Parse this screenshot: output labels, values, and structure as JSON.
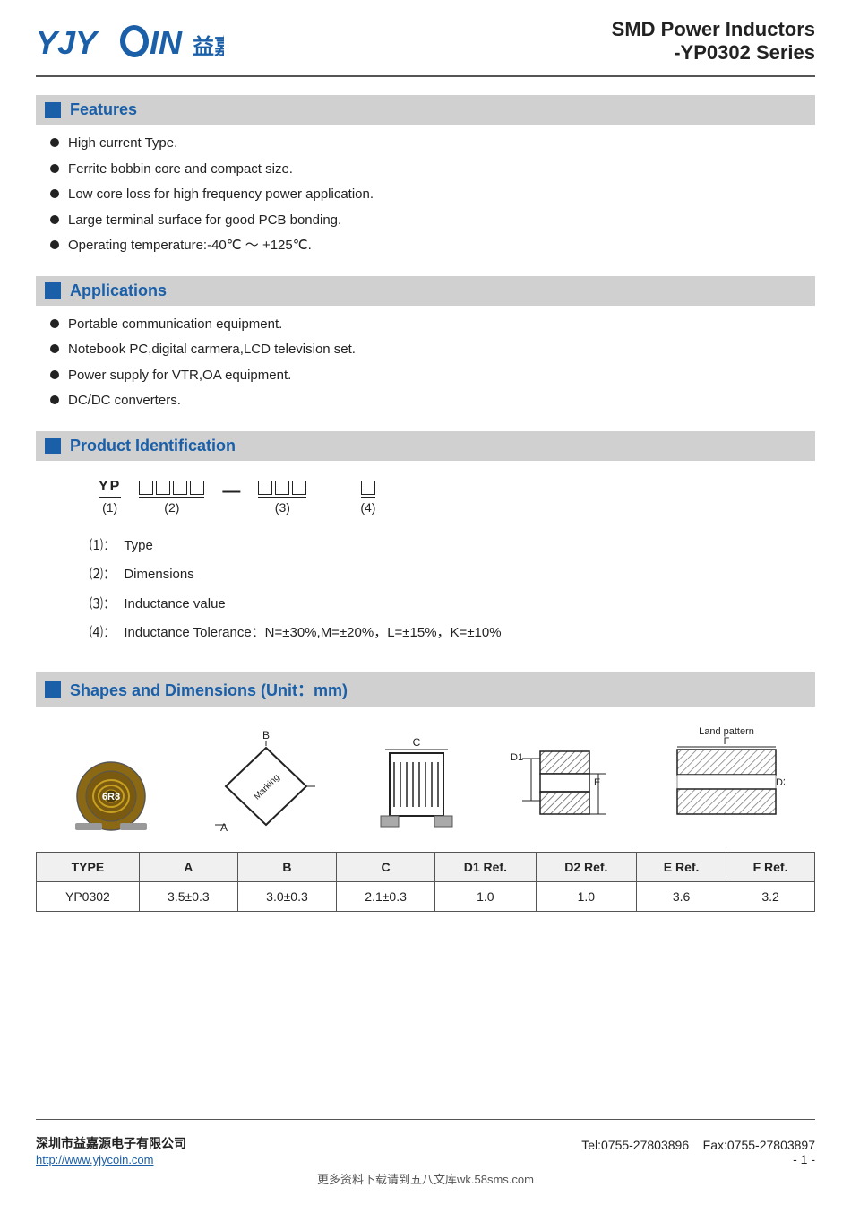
{
  "header": {
    "logo_text": "YJYCOIN",
    "logo_chinese": "益嘉源",
    "title_line1": "SMD Power Inductors",
    "title_line2": "-YP0302 Series"
  },
  "sections": {
    "features": {
      "label": "Features",
      "items": [
        "High current Type.",
        "Ferrite bobbin core and compact size.",
        "Low core loss for high frequency power application.",
        "Large terminal surface for good PCB bonding.",
        "Operating temperature:-40℃ ～ +125℃."
      ]
    },
    "applications": {
      "label": "Applications",
      "items": [
        "Portable communication equipment.",
        "Notebook PC,digital carmera,LCD television set.",
        "Power supply for VTR,OA equipment.",
        "DC/DC converters."
      ]
    },
    "product_id": {
      "label": "Product Identification",
      "code_part1": "YP",
      "code_part1_num": "(1)",
      "code_part2_num": "(2)",
      "code_part3_num": "(3)",
      "code_part4_num": "(4)",
      "descriptions": [
        {
          "num": "(1)：",
          "text": "Type"
        },
        {
          "num": "(2)：",
          "text": "Dimensions"
        },
        {
          "num": "(3)：",
          "text": "Inductance value"
        },
        {
          "num": "(4)：",
          "text": "Inductance Tolerance：N=±30%,M=±20%，L=±15%，K=±10%"
        }
      ]
    },
    "shapes": {
      "label": "Shapes and Dimensions (Unit：mm)",
      "table": {
        "headers": [
          "TYPE",
          "A",
          "B",
          "C",
          "D1 Ref.",
          "D2 Ref.",
          "E Ref.",
          "F Ref."
        ],
        "rows": [
          [
            "YP0302",
            "3.5±0.3",
            "3.0±0.3",
            "2.1±0.3",
            "1.0",
            "1.0",
            "3.6",
            "3.2"
          ]
        ]
      }
    }
  },
  "footer": {
    "company": "深圳市益嘉源电子有限公司",
    "tel": "Tel:0755-27803896",
    "fax": "Fax:0755-27803897",
    "website": "http://www.yjycoin.com",
    "page": "- 1 -"
  },
  "watermark": "更多资料下载请到五八文库wk.58sms.com"
}
